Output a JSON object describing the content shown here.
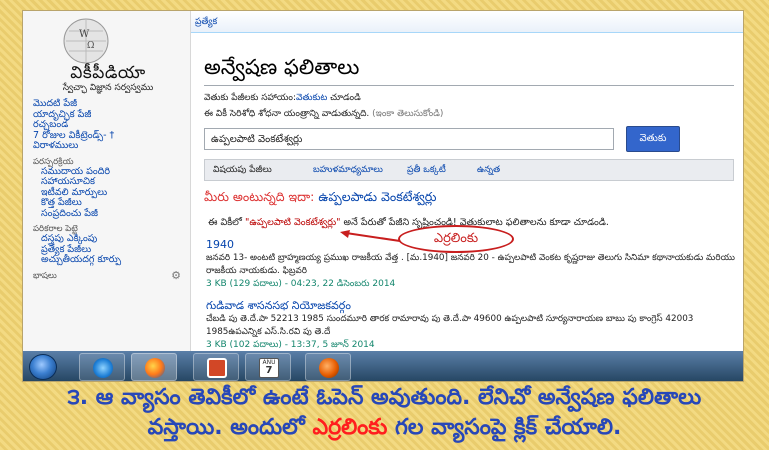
{
  "wiki": {
    "title": "వికీపీడియా",
    "tagline": "స్వేచ్ఛా విజ్ఞాన సర్వస్వము",
    "nav_main": [
      "మొదటి పేజీ",
      "యాదృచ్ఛిక పేజీ",
      "రచ్చబండ",
      "7 రోజుల వికీట్రెండ్స్- †",
      "విరాళములు"
    ],
    "section_interaction": "పరస్పరక్రియ",
    "nav_interaction": [
      "సముదాయ పందిరి",
      "సహాయసూచిక",
      "ఇటీవలి మార్పులు",
      "కొత్త పేజీలు",
      "సంప్రదించు పేజీ"
    ],
    "section_tools": "పరికరాల పెట్టె",
    "nav_tools": [
      "దస్త్రపు ఎక్కింపు",
      "ప్రత్యేక పేజీలు",
      "అచ్చుతీయదగ్గ కూర్పు"
    ],
    "section_languages": "భాషలు",
    "tab_special": "ప్రత్యేక",
    "page_title": "అన్వేషణ ఫలితాలు",
    "help_prefix": "వెతుకు పేజీలకు సహాయం:",
    "help_link": "వెతుకుట",
    "help_suffix": " చూడండి",
    "note_text": "ఈ వికీ సెరిశోధి శోధనా యంత్రాన్ని వాడుతున్నది. ",
    "note_link": "(ఇంకా తెలుసుకోండి)",
    "search_value": "ఉప్పలపాటి వెంకటేశ్వర్లు",
    "search_button": "వెతుకు",
    "filters": [
      "విషయపు పేజీలు",
      "బహుళమాధ్యమాలు",
      "ప్రతీ ఒక్కటీ",
      "ఉన్నత"
    ],
    "did_you_mean_prefix": "మీరు అంటున్నది ఇదా: ",
    "did_you_mean_link": "ఉప్పలపాడు వెంకటేశ్వర్లు",
    "create_prefix": "ఈ వికీలో ",
    "create_link": "\"ఉప్పలపాటి వెంకటేశ్వర్లు\"",
    "create_suffix": " అనే పేరుతో పేజీని సృష్టించండి! వెతుకులాట ఫలితాలను కూడా చూడండి.",
    "badge": "ఎర్రలింకు",
    "results": [
      {
        "title": "1940",
        "snippet": "జనవరి 13- అంటటి బ్రాహ్మణయ్య ప్రముఖ రాజకీయ వేత్త . [మ.1940] జనవరి 20 - ఉప్పలపాటి వెంకట కృష్ణరాజు తెలుగు సినిమా కథానాయకుడు మరియు రాజకీయ నాయకుడు. ఫిబ్రవరి",
        "meta": "3 KB (129 పదాలు) - 04:23, 22 డిసెంబరు 2014"
      },
      {
        "title": "గుడివాడ శాసనసభ నియోజకవర్గం",
        "snippet": "చేబడి పు తె.దే.పా 52213 1985 సుందమూరి తారక రామారావు పు తె.దే.పా 49600 ఉప్పలపాటి సూర్యనారాయణ బాబు పు కాంగ్రెస్ 42003 1985ఉపఎన్నిక ఎస్.సి.రవి పు తె.దే",
        "meta": "3 KB (102 పదాలు) - 13:37, 5 జూన్ 2014"
      }
    ]
  },
  "taskbar": {
    "calendar_label": "ANU",
    "calendar_day": "7"
  },
  "caption": {
    "line1": "౩. ఆ వ్యాసం తెవికీలో ఉంటే ఓపెన్ అవుతుంది. లేనిచో అన్వేషణ ఫలితాలు",
    "line2_a": "వస్తాయి. అందులో ",
    "line2_red": "ఎర్రలింకు",
    "line2_b": " గల వ్యాసంపై క్లిక్ చేయాలి."
  }
}
